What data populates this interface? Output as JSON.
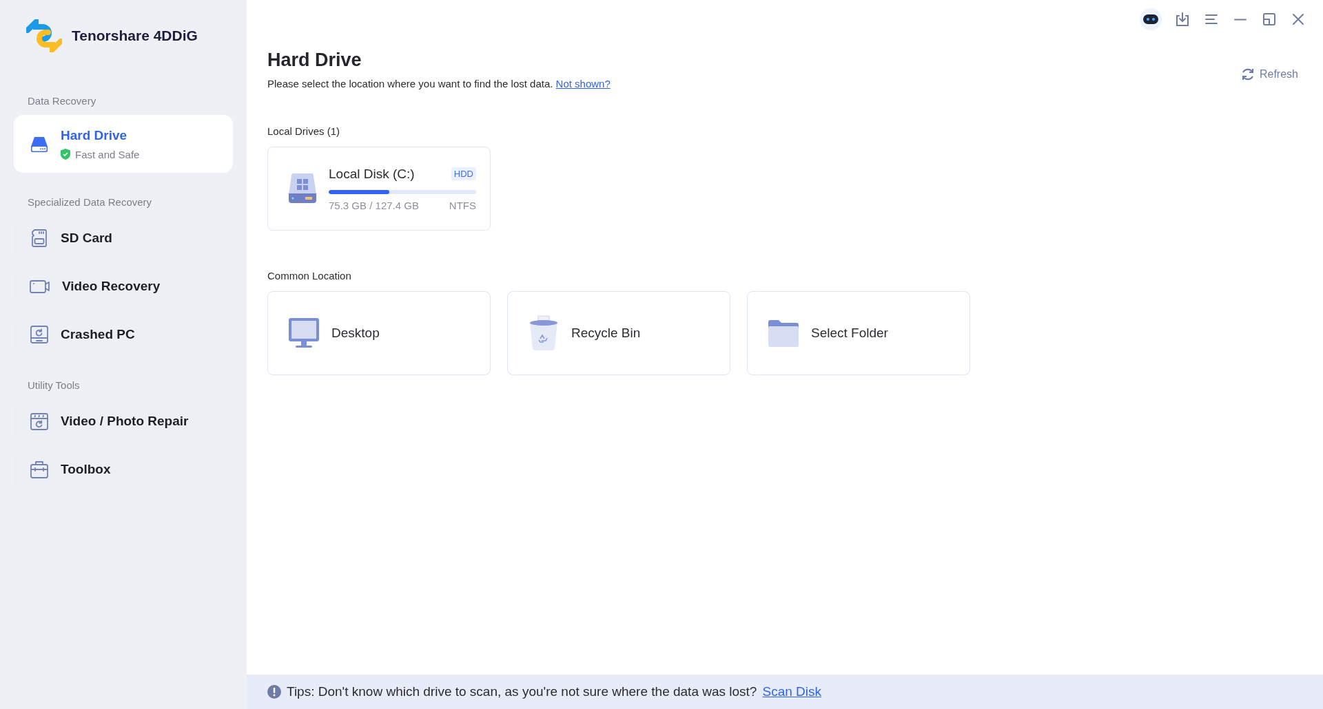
{
  "app": {
    "name": "Tenorshare 4DDiG"
  },
  "sidebar": {
    "sections": [
      {
        "heading": "Data Recovery",
        "items": [
          {
            "label": "Hard Drive",
            "subtitle": "Fast and Safe",
            "kind": "hdd",
            "selected": true
          }
        ]
      },
      {
        "heading": "Specialized Data Recovery",
        "items": [
          {
            "label": "SD Card",
            "kind": "sd",
            "selected": false
          },
          {
            "label": "Video Recovery",
            "kind": "video",
            "selected": false
          },
          {
            "label": "Crashed PC",
            "kind": "crashed",
            "selected": false
          }
        ]
      },
      {
        "heading": "Utility Tools",
        "items": [
          {
            "label": "Video / Photo Repair",
            "kind": "repair",
            "selected": false
          },
          {
            "label": "Toolbox",
            "kind": "toolbox",
            "selected": false
          }
        ]
      }
    ]
  },
  "main": {
    "title": "Hard Drive",
    "description": "Please select the location where you want to find the lost data.",
    "description_link": "Not shown?",
    "refresh": "Refresh",
    "local_drives": {
      "heading": "Local Drives (1)",
      "drives": [
        {
          "name": "Local Disk (C:)",
          "type": "HDD",
          "usage": "75.3 GB / 127.4 GB",
          "filesystem": "NTFS",
          "level": 0.41
        }
      ]
    },
    "common_location": {
      "heading": "Common Location",
      "locations": [
        {
          "label": "Desktop",
          "kind": "desktop"
        },
        {
          "label": "Recycle Bin",
          "kind": "recycle"
        },
        {
          "label": "Select Folder",
          "kind": "folder"
        }
      ]
    }
  },
  "tips": {
    "text": "Tips: Don't know which drive to scan, as you're not sure where the data was lost?",
    "link": "Scan Disk"
  }
}
